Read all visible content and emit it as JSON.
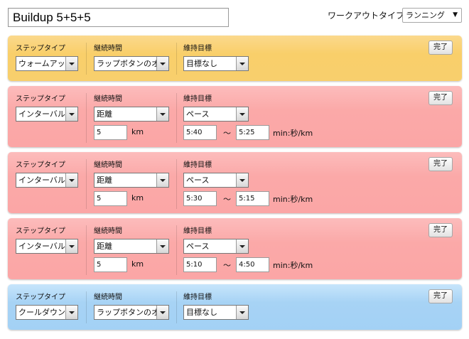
{
  "workout": {
    "name": "Buildup 5+5+5",
    "type_label": "ワークアウトタイプ:",
    "type_value": "ランニング"
  },
  "labels": {
    "step_type": "ステップタイプ",
    "duration": "継続時間",
    "target": "維持目標",
    "done": "完了",
    "range_sep": "〜"
  },
  "steps": [
    {
      "kind": "warmup",
      "type": "ウォームアップ",
      "duration": "ラップボタンのオン",
      "target": "目標なし"
    },
    {
      "kind": "interval",
      "type": "インターバル",
      "duration": "距離",
      "distance": "5",
      "distance_unit": "km",
      "target": "ペース",
      "pace_from": "5:40",
      "pace_to": "5:25",
      "pace_unit": "min:秒/km"
    },
    {
      "kind": "interval",
      "type": "インターバル",
      "duration": "距離",
      "distance": "5",
      "distance_unit": "km",
      "target": "ペース",
      "pace_from": "5:30",
      "pace_to": "5:15",
      "pace_unit": "min:秒/km"
    },
    {
      "kind": "interval",
      "type": "インターバル",
      "duration": "距離",
      "distance": "5",
      "distance_unit": "km",
      "target": "ペース",
      "pace_from": "5:10",
      "pace_to": "4:50",
      "pace_unit": "min:秒/km"
    },
    {
      "kind": "cooldown",
      "type": "クールダウン",
      "duration": "ラップボタンのオン",
      "target": "目標なし"
    }
  ],
  "colors": {
    "warmup": "#f9cf6a",
    "interval": "#fba9a8",
    "cooldown": "#a7d3f5"
  }
}
